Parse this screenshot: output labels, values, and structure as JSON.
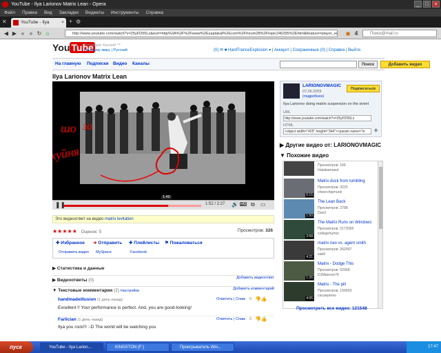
{
  "window": {
    "title": "YouTube - Ilya Larionov Matrix Lean - Opera"
  },
  "menu": [
    "Файл",
    "Правка",
    "Вид",
    "Закладки",
    "Виджеты",
    "Инструменты",
    "Справка"
  ],
  "tab": {
    "label": "YouTube - Ilya Larionov..."
  },
  "address": {
    "url": "http://www.youtube.com/watch?v=25yFD55Ls&eurl=http%3A%2F%2Fwww%2Eyaplakal%2Ecom%2Fforum28%2Ftopic246295%2Ehtml&feature=player_embedded",
    "search_placeholder": "Поиск@mail.ru"
  },
  "youtube": {
    "logo_you": "You",
    "logo_tube": "Tube",
    "tagline": "Broadcast Yourself ™",
    "tagline2": "По всему миру  |  Русский",
    "userbar": "(0) ✉ ■ HardTranceExplosion ▾  |  Аккаунт  |  Сохраненные (0)  |  Справка  |  Выйти",
    "nav": [
      "На главную",
      "Подписки",
      "Видео",
      "Каналы"
    ],
    "search_button": "Поиск",
    "upload_button": "Добавить видео"
  },
  "video": {
    "title": "Ilya Larionov Matrix Lean",
    "time": "1:52 / 2:27",
    "tooltip": "1:49",
    "progress_fraction": 0.76,
    "overlay_word1": "шо",
    "overlay_word2": "за",
    "overlay_word3": "хуйня",
    "response_text": "Это видеоответ на видео",
    "response_link": "matrix levitation",
    "rating_label": "Оценок: 5",
    "views_label": "Просмотров:",
    "views": "326"
  },
  "actions": {
    "favorite": "Избранное",
    "share": "Отправить",
    "playlists": "Плейлисты",
    "flag": "Пожаловаться",
    "share_sub1": "Отправить видео",
    "share_sub2": "MySpace",
    "share_sub3": "Facebook"
  },
  "sections": {
    "stats": "Статистика и данные",
    "video_responses": "Видеоответы",
    "video_responses_count": "(0)",
    "add_video_response": "Добавить видеоответ",
    "comments": "Текстовые комментарии",
    "comments_count": "(2)",
    "comments_settings": "Настройки",
    "add_comment": "Добавить комментарий"
  },
  "comments": [
    {
      "author": "handmadeillusion",
      "age": "(1 день назад)",
      "links": "Ответить  |  Спам",
      "score": "0",
      "text": "Excellent !! Your performance is perfect. And, you are good-looking!"
    },
    {
      "author": "Farlician",
      "age": "(1 день назад)",
      "links": "Ответить  |  Спам",
      "score": "0",
      "text": "Ilya you rock!!! :-D The world will be watching you"
    }
  ],
  "channel": {
    "name": "LARIONOVMAGIC",
    "date": "07.06.2009",
    "more": "(подробнее)",
    "subscribe": "Подписаться",
    "description": "Ilya Larionov doing matrix suspension on the street",
    "url_label": "URL",
    "url_value": "http://www.youtube.com/watch?v=25yFD55Ls",
    "embed_label": "HTML",
    "embed_value": "<object width=\"425\" height=\"344\"><param name=\"m"
  },
  "more_from": "Другие видео от: LARIONOVMAGIC",
  "related_header": "Похожие видео",
  "related": [
    {
      "title": "",
      "views": "Просмотров: 166",
      "author": "Hatakamasut",
      "duration": ""
    },
    {
      "title": "Matrix duck from tumbling",
      "views": "Просмотров: 3225",
      "author": "cheerchipmunk",
      "duration": "0:15"
    },
    {
      "title": "The Lean Back",
      "views": "Просмотров: 2788",
      "author": "Dan2",
      "duration": "1:50"
    },
    {
      "title": "The Matrix Runs on Windows",
      "views": "Просмотров: 2173356",
      "author": "collegehumor",
      "duration": "3:58"
    },
    {
      "title": "matrix neo vs. agent smith",
      "views": "Просмотров: 262057",
      "author": "sab0",
      "duration": "4:21"
    },
    {
      "title": "Matrix - Dodge This",
      "views": "Просмотров: 52958",
      "author": "DJMatrexe76",
      "duration": "1:26"
    },
    {
      "title": "Matrix - The pill",
      "views": "Просмотров: 156833",
      "author": "cacaeperes",
      "duration": "4:05"
    }
  ],
  "all_related": "Просмотреть все видео: 121548",
  "taskbar": {
    "start": "пуск",
    "tasks": [
      "YouTube - Ilya Larion...",
      "KINGSTON (F:)",
      "Проигрыватель Win..."
    ],
    "time": "17:47"
  }
}
